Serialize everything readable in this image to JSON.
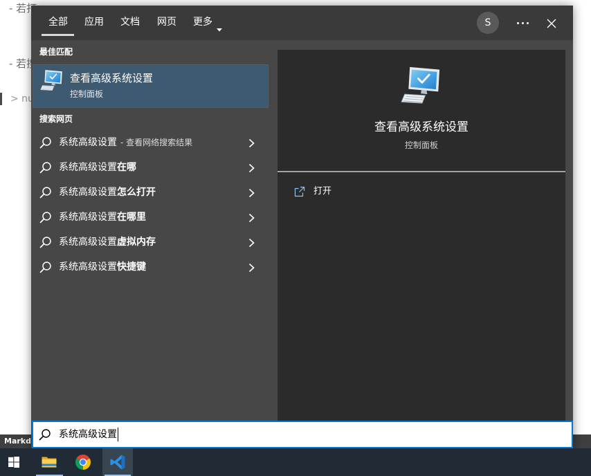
{
  "background_document": {
    "lines": [
      {
        "text": "- 若打"
      },
      {
        "text": "- 若搜"
      },
      {
        "text": "> nu"
      }
    ],
    "status_bar_label": "Markdo"
  },
  "search_panel": {
    "tabs": [
      {
        "label": "全部",
        "selected": true
      },
      {
        "label": "应用",
        "selected": false
      },
      {
        "label": "文档",
        "selected": false
      },
      {
        "label": "网页",
        "selected": false
      },
      {
        "label": "更多",
        "selected": false,
        "icon": "chevron-down-icon"
      }
    ],
    "account_initial": "S",
    "options_icon": "ellipsis-icon",
    "close_icon": "close-icon",
    "best_match": {
      "heading": "最佳匹配",
      "title": "查看高级系统设置",
      "subtitle": "控制面板",
      "icon": "system-computer-icon"
    },
    "web_search": {
      "heading": "搜索网页",
      "results": [
        {
          "query": "系统高级设置",
          "note": "- 查看网络搜索结果"
        },
        {
          "query": "系统高级设置",
          "suffix": "在哪"
        },
        {
          "query": "系统高级设置",
          "suffix": "怎么打开"
        },
        {
          "query": "系统高级设置",
          "suffix": "在哪里"
        },
        {
          "query": "系统高级设置",
          "suffix": "虚拟内存"
        },
        {
          "query": "系统高级设置",
          "suffix": "快捷键"
        }
      ]
    },
    "preview": {
      "icon": "system-computer-icon",
      "title": "查看高级系统设置",
      "subtitle": "控制面板",
      "actions": [
        {
          "label": "打开",
          "icon": "open-icon"
        }
      ]
    },
    "search_box": {
      "value": "系统高级设置",
      "icon": "search-icon"
    }
  },
  "taskbar": {
    "items": [
      {
        "icon": "windows-start-icon",
        "running": false,
        "active": false
      },
      {
        "icon": "file-explorer-icon",
        "running": true,
        "active": false
      },
      {
        "icon": "chrome-icon",
        "running": false,
        "active": false
      },
      {
        "icon": "vscode-icon",
        "running": true,
        "active": true
      }
    ]
  },
  "colors": {
    "page_bg": "#ffffff",
    "status_bar_bg": "#3f3f3f",
    "panel_bg": "#474747",
    "header_bg": "#3a3a3a",
    "preview_bg": "#2b2b2b",
    "best_match_bg": "#3e5a71",
    "best_match_outline": "#d02b2b",
    "accent": "#0078d7",
    "taskbar_bg": "#202b35"
  }
}
